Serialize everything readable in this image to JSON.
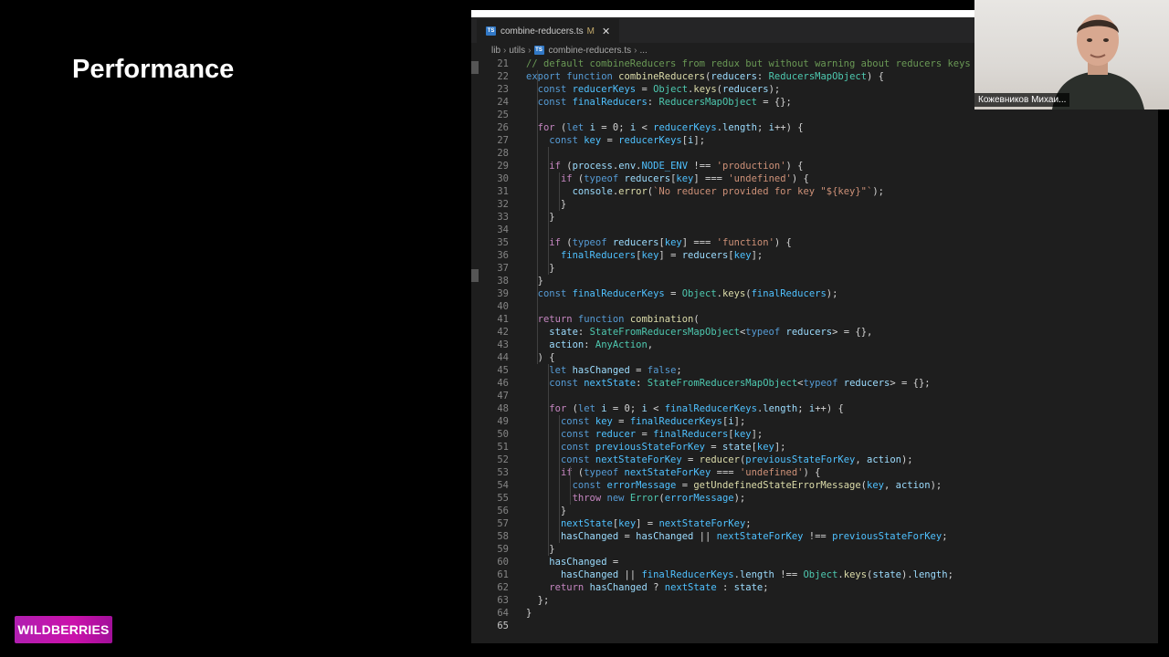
{
  "slide": {
    "title": "Performance",
    "logo": "WILDBERRIES"
  },
  "editor": {
    "tab": {
      "icon": "TS",
      "filename": "combine-reducers.ts",
      "modified": "M",
      "close": "✕"
    },
    "breadcrumb": [
      "lib",
      "utils",
      "combine-reducers.ts",
      "..."
    ],
    "active_line": 65,
    "lines": [
      {
        "n": "21",
        "t": [
          [
            "cmt",
            "// default combineReducers from redux but without warning about reducers keys !!!!"
          ]
        ]
      },
      {
        "n": "22",
        "t": [
          [
            "kw",
            "export "
          ],
          [
            "kw",
            "function "
          ],
          [
            "fn",
            "combineReducers"
          ],
          [
            "",
            "("
          ],
          [
            "var",
            "reducers"
          ],
          [
            "",
            ": "
          ],
          [
            "ty",
            "ReducersMapObject"
          ],
          [
            "",
            ") {"
          ]
        ]
      },
      {
        "n": "23",
        "t": [
          [
            "",
            "  "
          ],
          [
            "kw",
            "const "
          ],
          [
            "cn",
            "reducerKeys"
          ],
          [
            "",
            " = "
          ],
          [
            "ty",
            "Object"
          ],
          [
            "",
            "."
          ],
          [
            "fn",
            "keys"
          ],
          [
            "",
            "("
          ],
          [
            "var",
            "reducers"
          ],
          [
            "",
            ");"
          ]
        ]
      },
      {
        "n": "24",
        "t": [
          [
            "",
            "  "
          ],
          [
            "kw",
            "const "
          ],
          [
            "cn",
            "finalReducers"
          ],
          [
            "",
            ": "
          ],
          [
            "ty",
            "ReducersMapObject"
          ],
          [
            "",
            " = {};"
          ]
        ]
      },
      {
        "n": "25",
        "t": []
      },
      {
        "n": "26",
        "t": [
          [
            "",
            "  "
          ],
          [
            "ctl",
            "for "
          ],
          [
            "",
            "("
          ],
          [
            "kw",
            "let "
          ],
          [
            "var",
            "i"
          ],
          [
            "",
            " = 0; "
          ],
          [
            "var",
            "i"
          ],
          [
            "",
            " < "
          ],
          [
            "cn",
            "reducerKeys"
          ],
          [
            "",
            "."
          ],
          [
            "var",
            "length"
          ],
          [
            "",
            "; "
          ],
          [
            "var",
            "i"
          ],
          [
            "",
            "++) {"
          ]
        ]
      },
      {
        "n": "27",
        "t": [
          [
            "",
            "    "
          ],
          [
            "kw",
            "const "
          ],
          [
            "cn",
            "key"
          ],
          [
            "",
            " = "
          ],
          [
            "cn",
            "reducerKeys"
          ],
          [
            "",
            "["
          ],
          [
            "var",
            "i"
          ],
          [
            "",
            "];"
          ]
        ]
      },
      {
        "n": "28",
        "t": []
      },
      {
        "n": "29",
        "t": [
          [
            "",
            "    "
          ],
          [
            "ctl",
            "if "
          ],
          [
            "",
            "("
          ],
          [
            "var",
            "process"
          ],
          [
            "",
            "."
          ],
          [
            "var",
            "env"
          ],
          [
            "",
            "."
          ],
          [
            "cn",
            "NODE_ENV"
          ],
          [
            "",
            " !== "
          ],
          [
            "str",
            "'production'"
          ],
          [
            "",
            ") {"
          ]
        ]
      },
      {
        "n": "30",
        "t": [
          [
            "",
            "      "
          ],
          [
            "ctl",
            "if "
          ],
          [
            "",
            "("
          ],
          [
            "kw",
            "typeof "
          ],
          [
            "var",
            "reducers"
          ],
          [
            "",
            "["
          ],
          [
            "cn",
            "key"
          ],
          [
            "",
            "] === "
          ],
          [
            "str",
            "'undefined'"
          ],
          [
            "",
            ") {"
          ]
        ]
      },
      {
        "n": "31",
        "t": [
          [
            "",
            "        "
          ],
          [
            "var",
            "console"
          ],
          [
            "",
            "."
          ],
          [
            "fn",
            "error"
          ],
          [
            "",
            "("
          ],
          [
            "str",
            "`No reducer provided for key \"${key}\"`"
          ],
          [
            "",
            ");"
          ]
        ]
      },
      {
        "n": "32",
        "t": [
          [
            "",
            "      }"
          ]
        ]
      },
      {
        "n": "33",
        "t": [
          [
            "",
            "    }"
          ]
        ]
      },
      {
        "n": "34",
        "t": []
      },
      {
        "n": "35",
        "t": [
          [
            "",
            "    "
          ],
          [
            "ctl",
            "if "
          ],
          [
            "",
            "("
          ],
          [
            "kw",
            "typeof "
          ],
          [
            "var",
            "reducers"
          ],
          [
            "",
            "["
          ],
          [
            "cn",
            "key"
          ],
          [
            "",
            "] === "
          ],
          [
            "str",
            "'function'"
          ],
          [
            "",
            ") {"
          ]
        ]
      },
      {
        "n": "36",
        "t": [
          [
            "",
            "      "
          ],
          [
            "cn",
            "finalReducers"
          ],
          [
            "",
            "["
          ],
          [
            "cn",
            "key"
          ],
          [
            "",
            "] = "
          ],
          [
            "var",
            "reducers"
          ],
          [
            "",
            "["
          ],
          [
            "cn",
            "key"
          ],
          [
            "",
            "];"
          ]
        ]
      },
      {
        "n": "37",
        "t": [
          [
            "",
            "    }"
          ]
        ]
      },
      {
        "n": "38",
        "t": [
          [
            "",
            "  }"
          ]
        ]
      },
      {
        "n": "39",
        "t": [
          [
            "",
            "  "
          ],
          [
            "kw",
            "const "
          ],
          [
            "cn",
            "finalReducerKeys"
          ],
          [
            "",
            " = "
          ],
          [
            "ty",
            "Object"
          ],
          [
            "",
            "."
          ],
          [
            "fn",
            "keys"
          ],
          [
            "",
            "("
          ],
          [
            "cn",
            "finalReducers"
          ],
          [
            "",
            ");"
          ]
        ]
      },
      {
        "n": "40",
        "t": []
      },
      {
        "n": "41",
        "t": [
          [
            "",
            "  "
          ],
          [
            "ctl",
            "return "
          ],
          [
            "kw",
            "function "
          ],
          [
            "fn",
            "combination"
          ],
          [
            "",
            "("
          ]
        ]
      },
      {
        "n": "42",
        "t": [
          [
            "",
            "    "
          ],
          [
            "var",
            "state"
          ],
          [
            "",
            ": "
          ],
          [
            "ty",
            "StateFromReducersMapObject"
          ],
          [
            "",
            "<"
          ],
          [
            "kw",
            "typeof "
          ],
          [
            "var",
            "reducers"
          ],
          [
            "",
            "> = {},"
          ]
        ]
      },
      {
        "n": "43",
        "t": [
          [
            "",
            "    "
          ],
          [
            "var",
            "action"
          ],
          [
            "",
            ": "
          ],
          [
            "ty",
            "AnyAction"
          ],
          [
            "",
            ","
          ]
        ]
      },
      {
        "n": "44",
        "t": [
          [
            "",
            "  ) {"
          ]
        ]
      },
      {
        "n": "45",
        "t": [
          [
            "",
            "    "
          ],
          [
            "kw",
            "let "
          ],
          [
            "var",
            "hasChanged"
          ],
          [
            "",
            " = "
          ],
          [
            "kw",
            "false"
          ],
          [
            "",
            ";"
          ]
        ]
      },
      {
        "n": "46",
        "t": [
          [
            "",
            "    "
          ],
          [
            "kw",
            "const "
          ],
          [
            "cn",
            "nextState"
          ],
          [
            "",
            ": "
          ],
          [
            "ty",
            "StateFromReducersMapObject"
          ],
          [
            "",
            "<"
          ],
          [
            "kw",
            "typeof "
          ],
          [
            "var",
            "reducers"
          ],
          [
            "",
            "> = {};"
          ]
        ]
      },
      {
        "n": "47",
        "t": []
      },
      {
        "n": "48",
        "t": [
          [
            "",
            "    "
          ],
          [
            "ctl",
            "for "
          ],
          [
            "",
            "("
          ],
          [
            "kw",
            "let "
          ],
          [
            "var",
            "i"
          ],
          [
            "",
            " = 0; "
          ],
          [
            "var",
            "i"
          ],
          [
            "",
            " < "
          ],
          [
            "cn",
            "finalReducerKeys"
          ],
          [
            "",
            "."
          ],
          [
            "var",
            "length"
          ],
          [
            "",
            "; "
          ],
          [
            "var",
            "i"
          ],
          [
            "",
            "++) {"
          ]
        ]
      },
      {
        "n": "49",
        "t": [
          [
            "",
            "      "
          ],
          [
            "kw",
            "const "
          ],
          [
            "cn",
            "key"
          ],
          [
            "",
            " = "
          ],
          [
            "cn",
            "finalReducerKeys"
          ],
          [
            "",
            "["
          ],
          [
            "var",
            "i"
          ],
          [
            "",
            "];"
          ]
        ]
      },
      {
        "n": "50",
        "t": [
          [
            "",
            "      "
          ],
          [
            "kw",
            "const "
          ],
          [
            "cn",
            "reducer"
          ],
          [
            "",
            " = "
          ],
          [
            "cn",
            "finalReducers"
          ],
          [
            "",
            "["
          ],
          [
            "cn",
            "key"
          ],
          [
            "",
            "];"
          ]
        ]
      },
      {
        "n": "51",
        "t": [
          [
            "",
            "      "
          ],
          [
            "kw",
            "const "
          ],
          [
            "cn",
            "previousStateForKey"
          ],
          [
            "",
            " = "
          ],
          [
            "var",
            "state"
          ],
          [
            "",
            "["
          ],
          [
            "cn",
            "key"
          ],
          [
            "",
            "];"
          ]
        ]
      },
      {
        "n": "52",
        "t": [
          [
            "",
            "      "
          ],
          [
            "kw",
            "const "
          ],
          [
            "cn",
            "nextStateForKey"
          ],
          [
            "",
            " = "
          ],
          [
            "fn",
            "reducer"
          ],
          [
            "",
            "("
          ],
          [
            "cn",
            "previousStateForKey"
          ],
          [
            "",
            ", "
          ],
          [
            "var",
            "action"
          ],
          [
            "",
            ");"
          ]
        ]
      },
      {
        "n": "53",
        "t": [
          [
            "",
            "      "
          ],
          [
            "ctl",
            "if "
          ],
          [
            "",
            "("
          ],
          [
            "kw",
            "typeof "
          ],
          [
            "cn",
            "nextStateForKey"
          ],
          [
            "",
            " === "
          ],
          [
            "str",
            "'undefined'"
          ],
          [
            "",
            ") {"
          ]
        ]
      },
      {
        "n": "54",
        "t": [
          [
            "",
            "        "
          ],
          [
            "kw",
            "const "
          ],
          [
            "cn",
            "errorMessage"
          ],
          [
            "",
            " = "
          ],
          [
            "fn",
            "getUndefinedStateErrorMessage"
          ],
          [
            "",
            "("
          ],
          [
            "cn",
            "key"
          ],
          [
            "",
            ", "
          ],
          [
            "var",
            "action"
          ],
          [
            "",
            ");"
          ]
        ]
      },
      {
        "n": "55",
        "t": [
          [
            "",
            "        "
          ],
          [
            "ctl",
            "throw "
          ],
          [
            "kw",
            "new "
          ],
          [
            "ty",
            "Error"
          ],
          [
            "",
            "("
          ],
          [
            "cn",
            "errorMessage"
          ],
          [
            "",
            ");"
          ]
        ]
      },
      {
        "n": "56",
        "t": [
          [
            "",
            "      }"
          ]
        ]
      },
      {
        "n": "57",
        "t": [
          [
            "",
            "      "
          ],
          [
            "cn",
            "nextState"
          ],
          [
            "",
            "["
          ],
          [
            "cn",
            "key"
          ],
          [
            "",
            "] = "
          ],
          [
            "cn",
            "nextStateForKey"
          ],
          [
            "",
            ";"
          ]
        ]
      },
      {
        "n": "58",
        "t": [
          [
            "",
            "      "
          ],
          [
            "var",
            "hasChanged"
          ],
          [
            "",
            " = "
          ],
          [
            "var",
            "hasChanged"
          ],
          [
            "",
            " || "
          ],
          [
            "cn",
            "nextStateForKey"
          ],
          [
            "",
            " !== "
          ],
          [
            "cn",
            "previousStateForKey"
          ],
          [
            "",
            ";"
          ]
        ]
      },
      {
        "n": "59",
        "t": [
          [
            "",
            "    }"
          ]
        ]
      },
      {
        "n": "60",
        "t": [
          [
            "",
            "    "
          ],
          [
            "var",
            "hasChanged"
          ],
          [
            "",
            " ="
          ]
        ]
      },
      {
        "n": "61",
        "t": [
          [
            "",
            "      "
          ],
          [
            "var",
            "hasChanged"
          ],
          [
            "",
            " || "
          ],
          [
            "cn",
            "finalReducerKeys"
          ],
          [
            "",
            "."
          ],
          [
            "var",
            "length"
          ],
          [
            "",
            " !== "
          ],
          [
            "ty",
            "Object"
          ],
          [
            "",
            "."
          ],
          [
            "fn",
            "keys"
          ],
          [
            "",
            "("
          ],
          [
            "var",
            "state"
          ],
          [
            "",
            ")."
          ],
          [
            "var",
            "length"
          ],
          [
            "",
            ";"
          ]
        ]
      },
      {
        "n": "62",
        "t": [
          [
            "",
            "    "
          ],
          [
            "ctl",
            "return "
          ],
          [
            "var",
            "hasChanged"
          ],
          [
            "",
            " ? "
          ],
          [
            "cn",
            "nextState"
          ],
          [
            "",
            " : "
          ],
          [
            "var",
            "state"
          ],
          [
            "",
            ";"
          ]
        ]
      },
      {
        "n": "63",
        "t": [
          [
            "",
            "  };"
          ]
        ]
      },
      {
        "n": "64",
        "t": [
          [
            "",
            "}"
          ]
        ]
      },
      {
        "n": "65",
        "t": []
      }
    ]
  },
  "webcam": {
    "name": "Кожевников Михаи..."
  }
}
